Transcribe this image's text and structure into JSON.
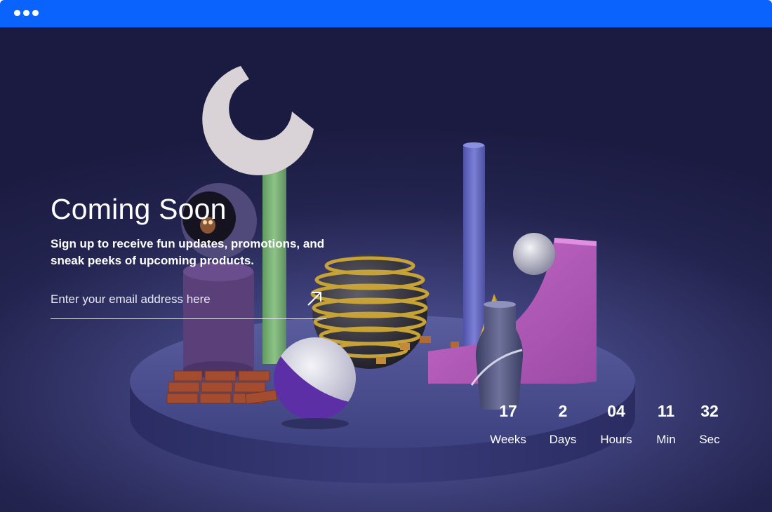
{
  "window": {
    "titlebar_color": "#0b63fd",
    "control_dots": [
      "dot",
      "dot",
      "dot"
    ]
  },
  "hero": {
    "title": "Coming Soon",
    "subtitle": "Sign up to receive fun updates, promotions, and sneak peeks of upcoming products."
  },
  "signup": {
    "email_placeholder": "Enter your email address here",
    "email_value": "",
    "submit_icon": "arrow-up-right-icon"
  },
  "countdown": [
    {
      "value": "17",
      "label": "Weeks"
    },
    {
      "value": "2",
      "label": "Days"
    },
    {
      "value": "04",
      "label": "Hours"
    },
    {
      "value": "11",
      "label": "Min"
    },
    {
      "value": "32",
      "label": "Sec"
    }
  ],
  "colors": {
    "accent": "#0b63fd",
    "background_dark": "#1b1b42",
    "stage": "#4a4d8c",
    "text": "#ffffff"
  }
}
